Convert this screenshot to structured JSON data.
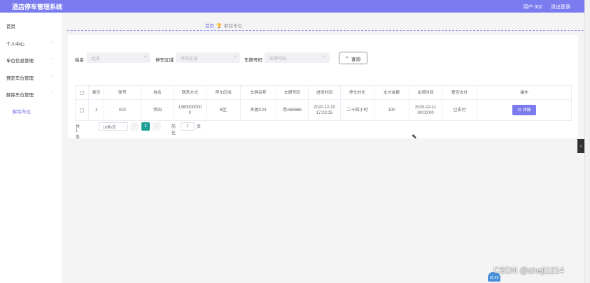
{
  "header": {
    "title": "酒店停车管理系统",
    "user": "用户 002",
    "logout": "退出登录"
  },
  "sidebar": {
    "items": [
      {
        "label": "首页"
      },
      {
        "label": "个人中心"
      },
      {
        "label": "车位信息管理"
      },
      {
        "label": "预定车位管理"
      },
      {
        "label": "解除车位管理"
      }
    ],
    "sub_item": "解除车位"
  },
  "breadcrumb": {
    "home": "首页",
    "current": "解除车位"
  },
  "search": {
    "name_label": "姓名",
    "name_placeholder": "姓名",
    "area_label": "停车区域",
    "area_placeholder": "停车区域",
    "plate_label": "车牌号码",
    "plate_placeholder": "车牌号码",
    "query_button": "查询"
  },
  "table": {
    "headers": [
      "索引",
      "账号",
      "姓名",
      "联系方式",
      "停车区域",
      "车辆名称",
      "车牌号码",
      "进场时间",
      "停车时长",
      "支付金额",
      "出场时间",
      "是否支付",
      "操作"
    ],
    "rows": [
      {
        "index": "1",
        "account": "002",
        "name": "李四",
        "phone": "13800000000",
        "area": "B区",
        "vehicle": "奔驰C23",
        "plate": "粤A66666",
        "entry_time": "2020-12-10 17:23:15",
        "duration": "二十四小时",
        "amount": "100",
        "exit_time": "2020-12-11 00:00:00",
        "paid": "已支付",
        "action": "详情"
      }
    ]
  },
  "pagination": {
    "total": "共 1 条",
    "page_size": "10条/页",
    "current_page": "1",
    "goto_label": "前往",
    "goto_value": "1",
    "page_suffix": "页"
  },
  "overlay": {
    "watermark": "CSDN @sheji1214",
    "time_badge": "01:43"
  },
  "colors": {
    "topbar": "#7b7bf0",
    "accent": "#6f6fe8",
    "pager_active": "#1aa094"
  }
}
